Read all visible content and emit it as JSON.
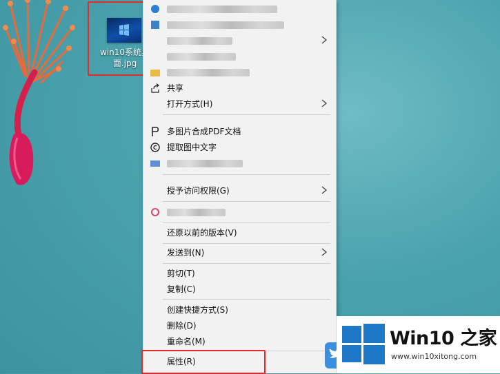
{
  "desktop": {
    "file_label": "win10系统桌面.jpg"
  },
  "context_menu": {
    "share": "共享",
    "open_with": "打开方式(H)",
    "merge_pdf": "多图片合成PDF文档",
    "extract_text": "提取图中文字",
    "grant_access": "授予访问权限(G)",
    "restore_versions": "还原以前的版本(V)",
    "send_to": "发送到(N)",
    "cut": "剪切(T)",
    "copy": "复制(C)",
    "create_shortcut": "创建快捷方式(S)",
    "delete": "删除(D)",
    "rename": "重命名(M)",
    "properties": "属性(R)"
  },
  "watermark": {
    "title": "Win10 之家",
    "url": "www.win10xitong.com"
  },
  "colors": {
    "highlight": "#e8292c",
    "menu_bg": "#f2f2f2",
    "logo_blue": "#1e78c8"
  }
}
